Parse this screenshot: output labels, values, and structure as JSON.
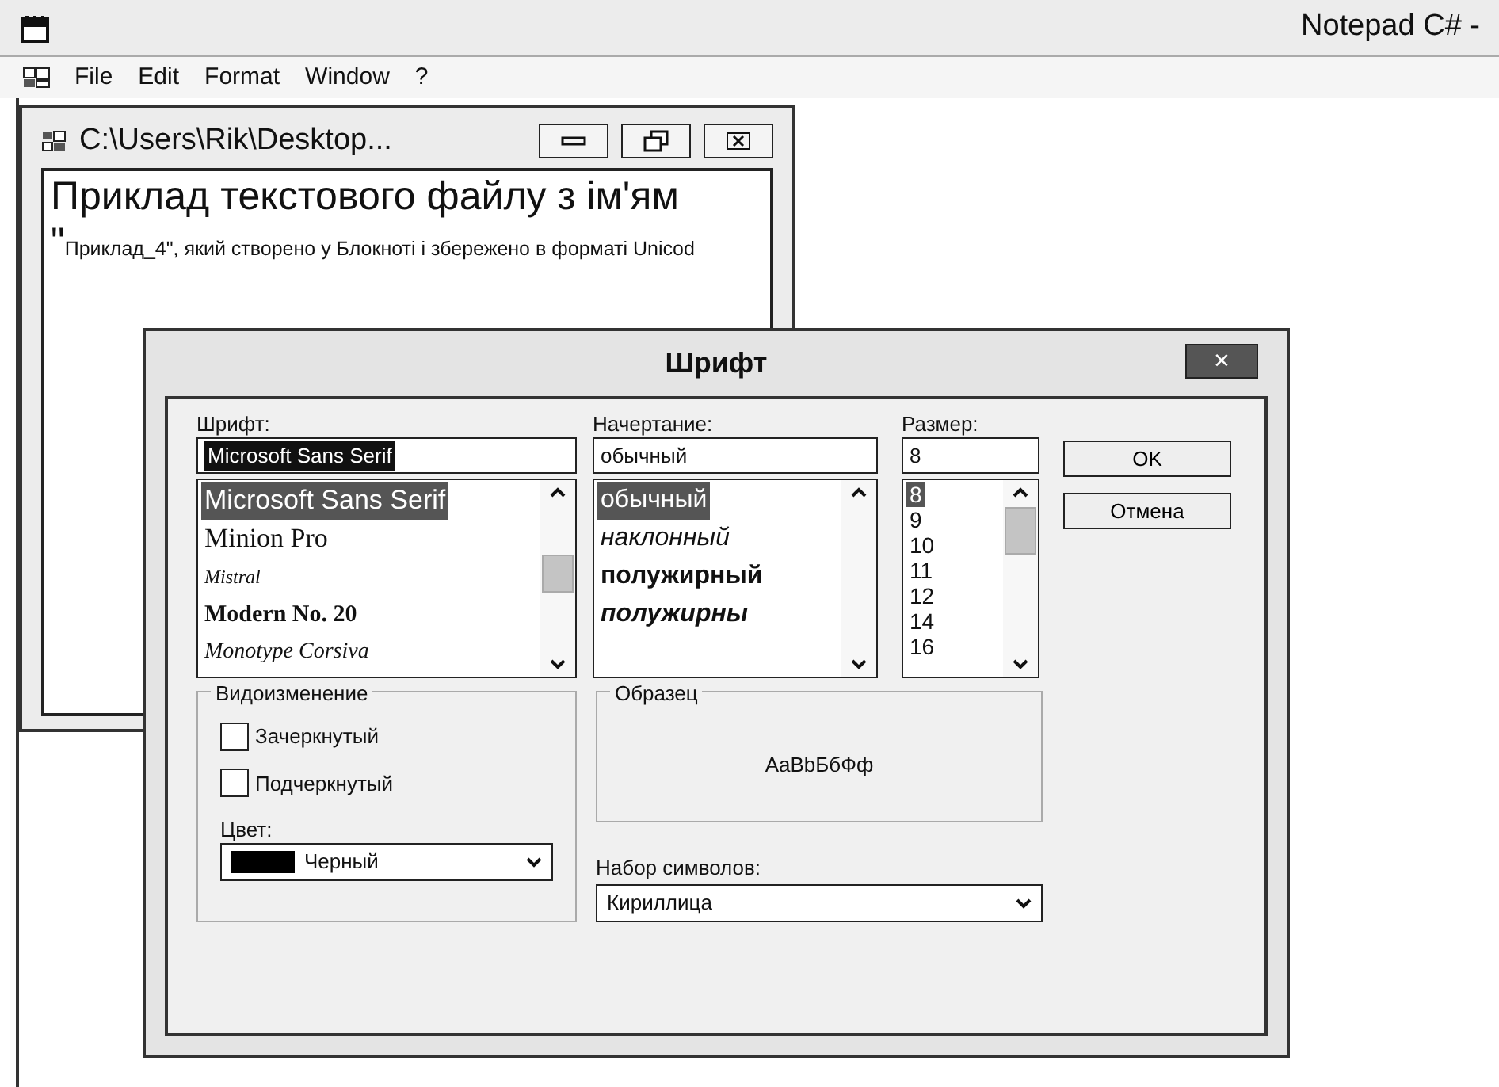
{
  "app": {
    "title": "Notepad C# -"
  },
  "menu": [
    "File",
    "Edit",
    "Format",
    "Window",
    "?"
  ],
  "child_window": {
    "title": "C:\\Users\\Rik\\Desktop...",
    "large_text": "Приклад текстового файлу з ім'ям \"",
    "small_text": "Приклад_4\", який створено у Блокноті і збережено в форматі Unicod"
  },
  "dialog": {
    "title": "Шрифт",
    "close": "×",
    "font": {
      "label": "Шрифт:",
      "value": "Microsoft Sans Serif",
      "highlighted": true,
      "items": [
        {
          "label": "Microsoft Sans Serif",
          "kind": "sans",
          "selected": true
        },
        {
          "label": "Minion Pro",
          "kind": "serif",
          "selected": false
        },
        {
          "label": "Mistral",
          "kind": "script",
          "selected": false
        },
        {
          "label": "Modern No. 20",
          "kind": "modern",
          "selected": false
        },
        {
          "label": "Monotype Corsiva",
          "kind": "italic",
          "selected": false
        }
      ]
    },
    "style": {
      "label": "Начертание:",
      "value": "обычный",
      "highlighted": false,
      "items": [
        {
          "label": "обычный",
          "kind": "regular",
          "selected": true
        },
        {
          "label": "наклонный",
          "kind": "italic",
          "selected": false
        },
        {
          "label": "полужирный",
          "kind": "bold",
          "selected": false
        },
        {
          "label": "полужирны",
          "kind": "bold-italic",
          "selected": false
        }
      ]
    },
    "size": {
      "label": "Размер:",
      "value": "8",
      "highlighted": false,
      "items": [
        {
          "label": "8",
          "selected": true
        },
        {
          "label": "9",
          "selected": false
        },
        {
          "label": "10",
          "selected": false
        },
        {
          "label": "11",
          "selected": false
        },
        {
          "label": "12",
          "selected": false
        },
        {
          "label": "14",
          "selected": false
        },
        {
          "label": "16",
          "selected": false
        }
      ]
    },
    "buttons": [
      "OK",
      "Отмена"
    ],
    "effects": {
      "title": "Видоизменение",
      "checkboxes": [
        {
          "label": "Зачеркнутый",
          "checked": false
        },
        {
          "label": "Подчеркнутый",
          "checked": false
        }
      ],
      "color_label": "Цвет:",
      "color": {
        "value": "Черный",
        "color": "#000000"
      }
    },
    "sample": {
      "title": "Образец",
      "text": "AaBbБбФф"
    },
    "charset": {
      "label": "Набор символов:",
      "value": "Кириллица"
    }
  }
}
